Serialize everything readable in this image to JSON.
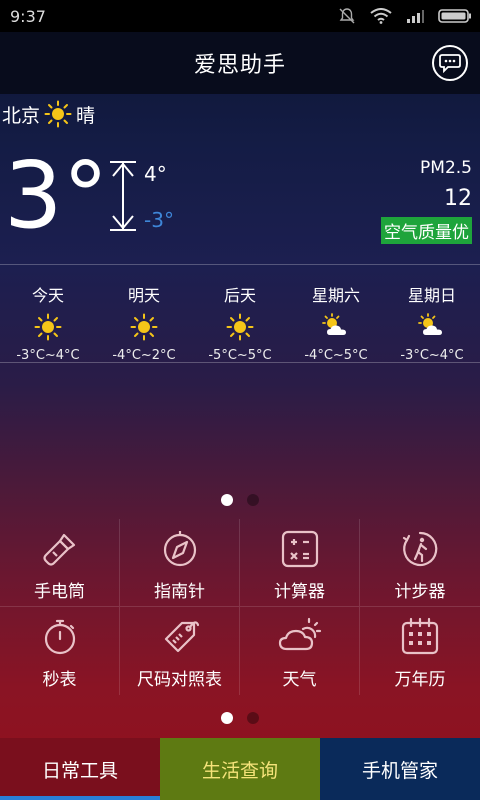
{
  "status": {
    "time": "9:37",
    "icons": [
      "mute-icon",
      "wifi-icon",
      "signal-icon",
      "battery-icon"
    ]
  },
  "header": {
    "title": "爱思助手",
    "chat_icon": "chat-bubble-icon"
  },
  "current": {
    "city": "北京",
    "condition": "晴",
    "condition_icon": "sun-icon",
    "temp": "3°",
    "high": "4°",
    "low": "-3°",
    "pm_label": "PM2.5",
    "pm_value": "12",
    "air_quality": "空气质量优"
  },
  "forecast": [
    {
      "day": "今天",
      "icon": "sun-icon",
      "range": "-3°C~4°C"
    },
    {
      "day": "明天",
      "icon": "sun-icon",
      "range": "-4°C~2°C"
    },
    {
      "day": "后天",
      "icon": "sun-icon",
      "range": "-5°C~5°C"
    },
    {
      "day": "星期六",
      "icon": "sun-cloud-icon",
      "range": "-4°C~5°C"
    },
    {
      "day": "星期日",
      "icon": "sun-cloud-icon",
      "range": "-3°C~4°C"
    }
  ],
  "pager_weather": {
    "pages": 2,
    "active": 1
  },
  "tools": [
    {
      "label": "手电筒",
      "icon": "flashlight-icon"
    },
    {
      "label": "指南针",
      "icon": "compass-icon"
    },
    {
      "label": "计算器",
      "icon": "calculator-icon"
    },
    {
      "label": "计步器",
      "icon": "pedometer-icon"
    },
    {
      "label": "秒表",
      "icon": "stopwatch-icon"
    },
    {
      "label": "尺码对照表",
      "icon": "size-tag-icon"
    },
    {
      "label": "天气",
      "icon": "weather-icon"
    },
    {
      "label": "万年历",
      "icon": "calendar-icon"
    }
  ],
  "pager_tools": {
    "pages": 2,
    "active": 1
  },
  "tabs": [
    {
      "label": "日常工具",
      "selected": true
    },
    {
      "label": "生活查询",
      "selected": false
    },
    {
      "label": "手机管家",
      "selected": false
    }
  ],
  "colors": {
    "air_quality_bg": "#1ea43b",
    "low_temp": "#3e86d8",
    "sun": "#f5c518"
  }
}
